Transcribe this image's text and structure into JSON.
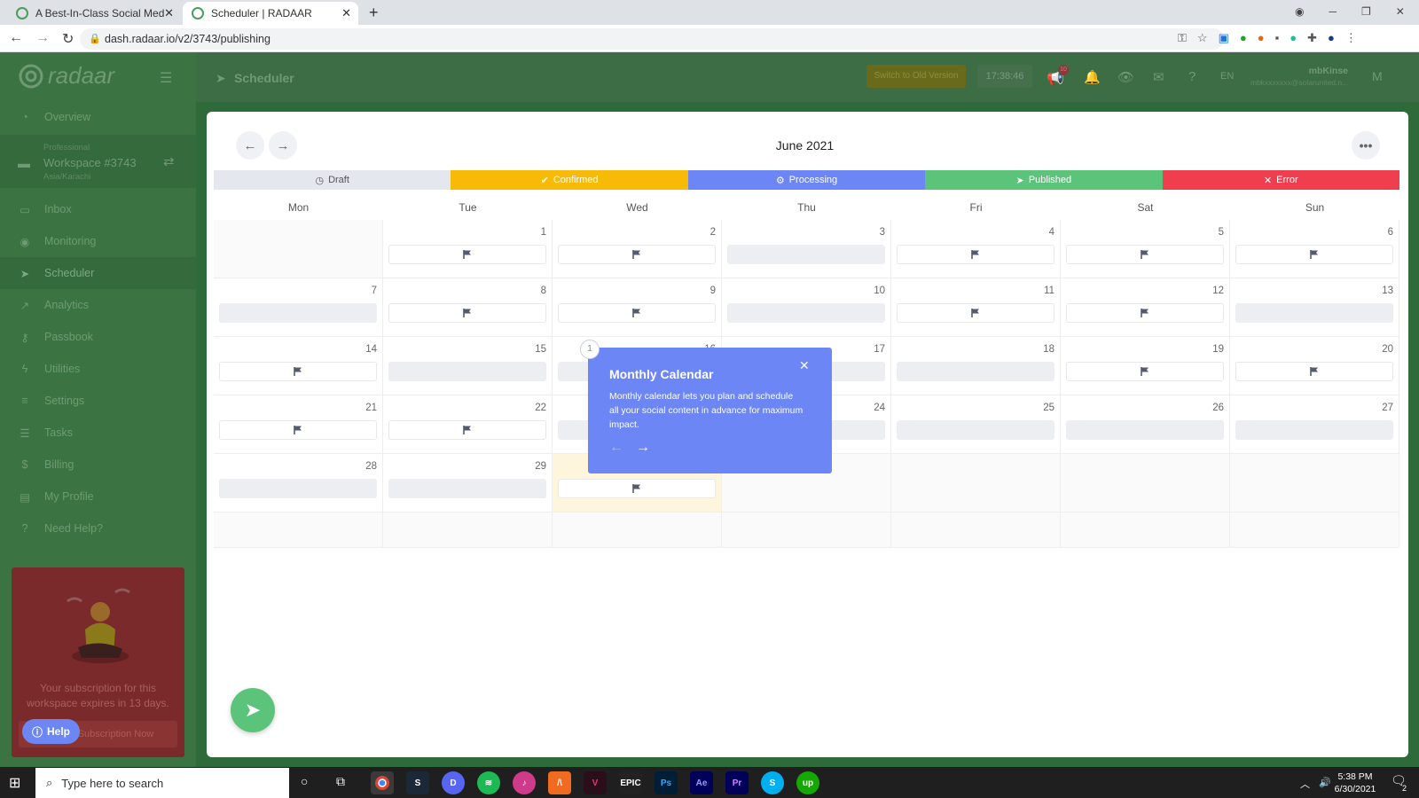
{
  "browser": {
    "tabs": [
      {
        "title": "A Best-In-Class Social Media Ma"
      },
      {
        "title": "Scheduler | RADAAR"
      }
    ],
    "url": "dash.radaar.io/v2/3743/publishing"
  },
  "app": {
    "logo": "radaar",
    "header": {
      "page_title": "Scheduler",
      "switch_button": "Switch to Old Version",
      "clock": "17:38:46",
      "notif_count": "10",
      "lang": "EN",
      "user_name": "mbKinse",
      "user_email": "mbkxxxxxxx@solarunited.n...",
      "avatar_initial": "M"
    },
    "workspace": {
      "plan": "Professional",
      "name": "Workspace #3743",
      "timezone": "Asia/Karachi"
    },
    "nav": [
      {
        "label": "Overview",
        "icon": "dashboard-icon"
      },
      {
        "label": "Inbox",
        "icon": "inbox-icon"
      },
      {
        "label": "Monitoring",
        "icon": "eye-icon"
      },
      {
        "label": "Scheduler",
        "icon": "paper-plane-icon"
      },
      {
        "label": "Analytics",
        "icon": "chart-icon"
      },
      {
        "label": "Passbook",
        "icon": "key-icon"
      },
      {
        "label": "Utilities",
        "icon": "bolt-icon"
      },
      {
        "label": "Settings",
        "icon": "sliders-icon"
      },
      {
        "label": "Tasks",
        "icon": "list-icon"
      },
      {
        "label": "Billing",
        "icon": "dollar-icon"
      },
      {
        "label": "My Profile",
        "icon": "id-card-icon"
      },
      {
        "label": "Need Help?",
        "icon": "question-icon"
      }
    ],
    "subscription": {
      "text": "Your subscription for this workspace expires in 13 days.",
      "button": "Subscription Now"
    },
    "help_button": "Help"
  },
  "calendar": {
    "month": "June 2021",
    "legend": [
      {
        "label": "Draft",
        "color": "#e5e7ee",
        "text_color": "#555555"
      },
      {
        "label": "Confirmed",
        "color": "#f7bb07",
        "text_color": "#ffffff"
      },
      {
        "label": "Processing",
        "color": "#6c86f5",
        "text_color": "#ffffff"
      },
      {
        "label": "Published",
        "color": "#5cc47a",
        "text_color": "#ffffff"
      },
      {
        "label": "Error",
        "color": "#ef3f4f",
        "text_color": "#ffffff"
      }
    ],
    "weekdays": [
      "Mon",
      "Tue",
      "Wed",
      "Thu",
      "Fri",
      "Sat",
      "Sun"
    ],
    "weeks": [
      [
        null,
        {
          "d": "1",
          "s": "flag"
        },
        {
          "d": "2",
          "s": "flag"
        },
        {
          "d": "3",
          "s": "empty"
        },
        {
          "d": "4",
          "s": "flag"
        },
        {
          "d": "5",
          "s": "flag"
        },
        {
          "d": "6",
          "s": "flag"
        }
      ],
      [
        {
          "d": "7",
          "s": "empty"
        },
        {
          "d": "8",
          "s": "flag"
        },
        {
          "d": "9",
          "s": "flag"
        },
        {
          "d": "10",
          "s": "empty"
        },
        {
          "d": "11",
          "s": "flag"
        },
        {
          "d": "12",
          "s": "flag"
        },
        {
          "d": "13",
          "s": "empty"
        }
      ],
      [
        {
          "d": "14",
          "s": "flag"
        },
        {
          "d": "15",
          "s": "empty"
        },
        {
          "d": "16",
          "s": "empty"
        },
        {
          "d": "17",
          "s": "empty"
        },
        {
          "d": "18",
          "s": "empty"
        },
        {
          "d": "19",
          "s": "flag"
        },
        {
          "d": "20",
          "s": "flag"
        }
      ],
      [
        {
          "d": "21",
          "s": "flag"
        },
        {
          "d": "22",
          "s": "flag"
        },
        {
          "d": "23",
          "s": "empty"
        },
        {
          "d": "24",
          "s": "empty"
        },
        {
          "d": "25",
          "s": "empty"
        },
        {
          "d": "26",
          "s": "empty"
        },
        {
          "d": "27",
          "s": "empty"
        }
      ],
      [
        {
          "d": "28",
          "s": "empty"
        },
        {
          "d": "29",
          "s": "empty"
        },
        {
          "d": "",
          "s": "flag",
          "today": true
        },
        null,
        null,
        null,
        null
      ],
      [
        null,
        null,
        null,
        null,
        null,
        null,
        null
      ]
    ]
  },
  "tour": {
    "step": "1",
    "title": "Monthly Calendar",
    "body": "Monthly calendar lets you plan and schedule all your social content in advance for maximum impact."
  },
  "taskbar": {
    "search_placeholder": "Type here to search",
    "time": "5:38 PM",
    "date": "6/30/2021",
    "notifications": "2"
  }
}
